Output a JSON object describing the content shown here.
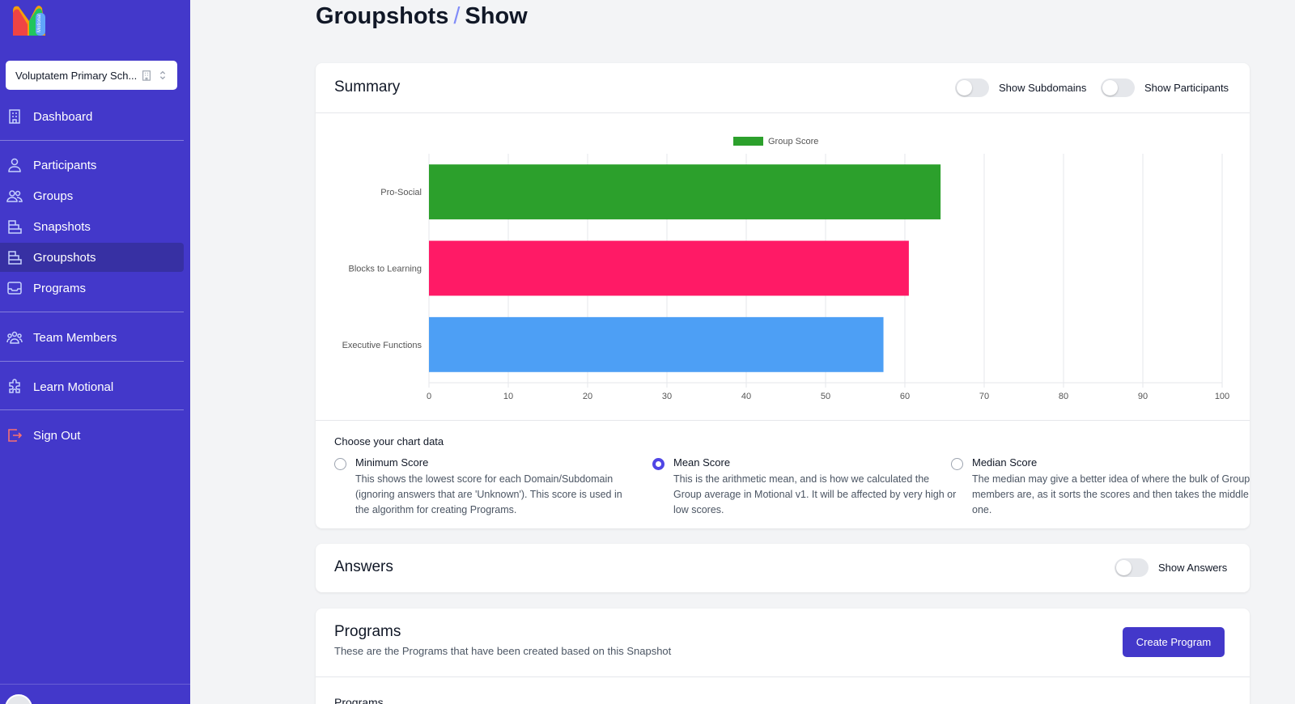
{
  "app": {
    "school": "Voluptatem Primary Sch...",
    "logo_text": "Motional"
  },
  "sidebar": {
    "items": [
      {
        "label": "Dashboard",
        "icon": "building-icon"
      },
      {
        "label": "Participants",
        "icon": "user-icon"
      },
      {
        "label": "Groups",
        "icon": "users-icon"
      },
      {
        "label": "Snapshots",
        "icon": "stack-icon"
      },
      {
        "label": "Groupshots",
        "icon": "stack-icon",
        "active": true
      },
      {
        "label": "Programs",
        "icon": "inbox-icon"
      },
      {
        "label": "Team Members",
        "icon": "team-icon"
      },
      {
        "label": "Learn Motional",
        "icon": "puzzle-icon"
      },
      {
        "label": "Sign Out",
        "icon": "sign-out-icon"
      }
    ]
  },
  "header": {
    "crumb1": "Groupshots",
    "separator": "/",
    "crumb2": "Show"
  },
  "summary": {
    "title": "Summary",
    "toggle_subdomains": "Show Subdomains",
    "toggle_participants": "Show Participants",
    "choose_label": "Choose your chart data",
    "options": [
      {
        "title": "Minimum Score",
        "desc": "This shows the lowest score for each Domain/Subdomain (ignoring answers that are 'Unknown'). This score is used in the algorithm for creating Programs.",
        "checked": false
      },
      {
        "title": "Mean Score",
        "desc": "This is the arithmetic mean, and is how we calculated the Group average in Motional v1. It will be affected by very high or low scores.",
        "checked": true
      },
      {
        "title": "Median Score",
        "desc": "The median may give a better idea of where the bulk of Group members are, as it sorts the scores and then takes the middle one.",
        "checked": false
      }
    ]
  },
  "chart_data": {
    "type": "bar",
    "orientation": "horizontal",
    "categories": [
      "Pro-Social",
      "Blocks to Learning",
      "Executive Functions"
    ],
    "series": [
      {
        "name": "Group Score",
        "values": [
          64.5,
          60.5,
          57.3
        ]
      }
    ],
    "bar_colors": [
      "#2ca02c",
      "#ff1a66",
      "#4d9ff5"
    ],
    "xlim": [
      0,
      100
    ],
    "xticks": [
      0,
      10,
      20,
      30,
      40,
      50,
      60,
      70,
      80,
      90,
      100
    ],
    "legend": "top-center",
    "grid": true
  },
  "answers": {
    "title": "Answers",
    "toggle": "Show Answers"
  },
  "programs": {
    "title": "Programs",
    "subtitle": "These are the Programs that have been created based on this Snapshot",
    "create_button": "Create Program",
    "section_label": "Programs"
  }
}
